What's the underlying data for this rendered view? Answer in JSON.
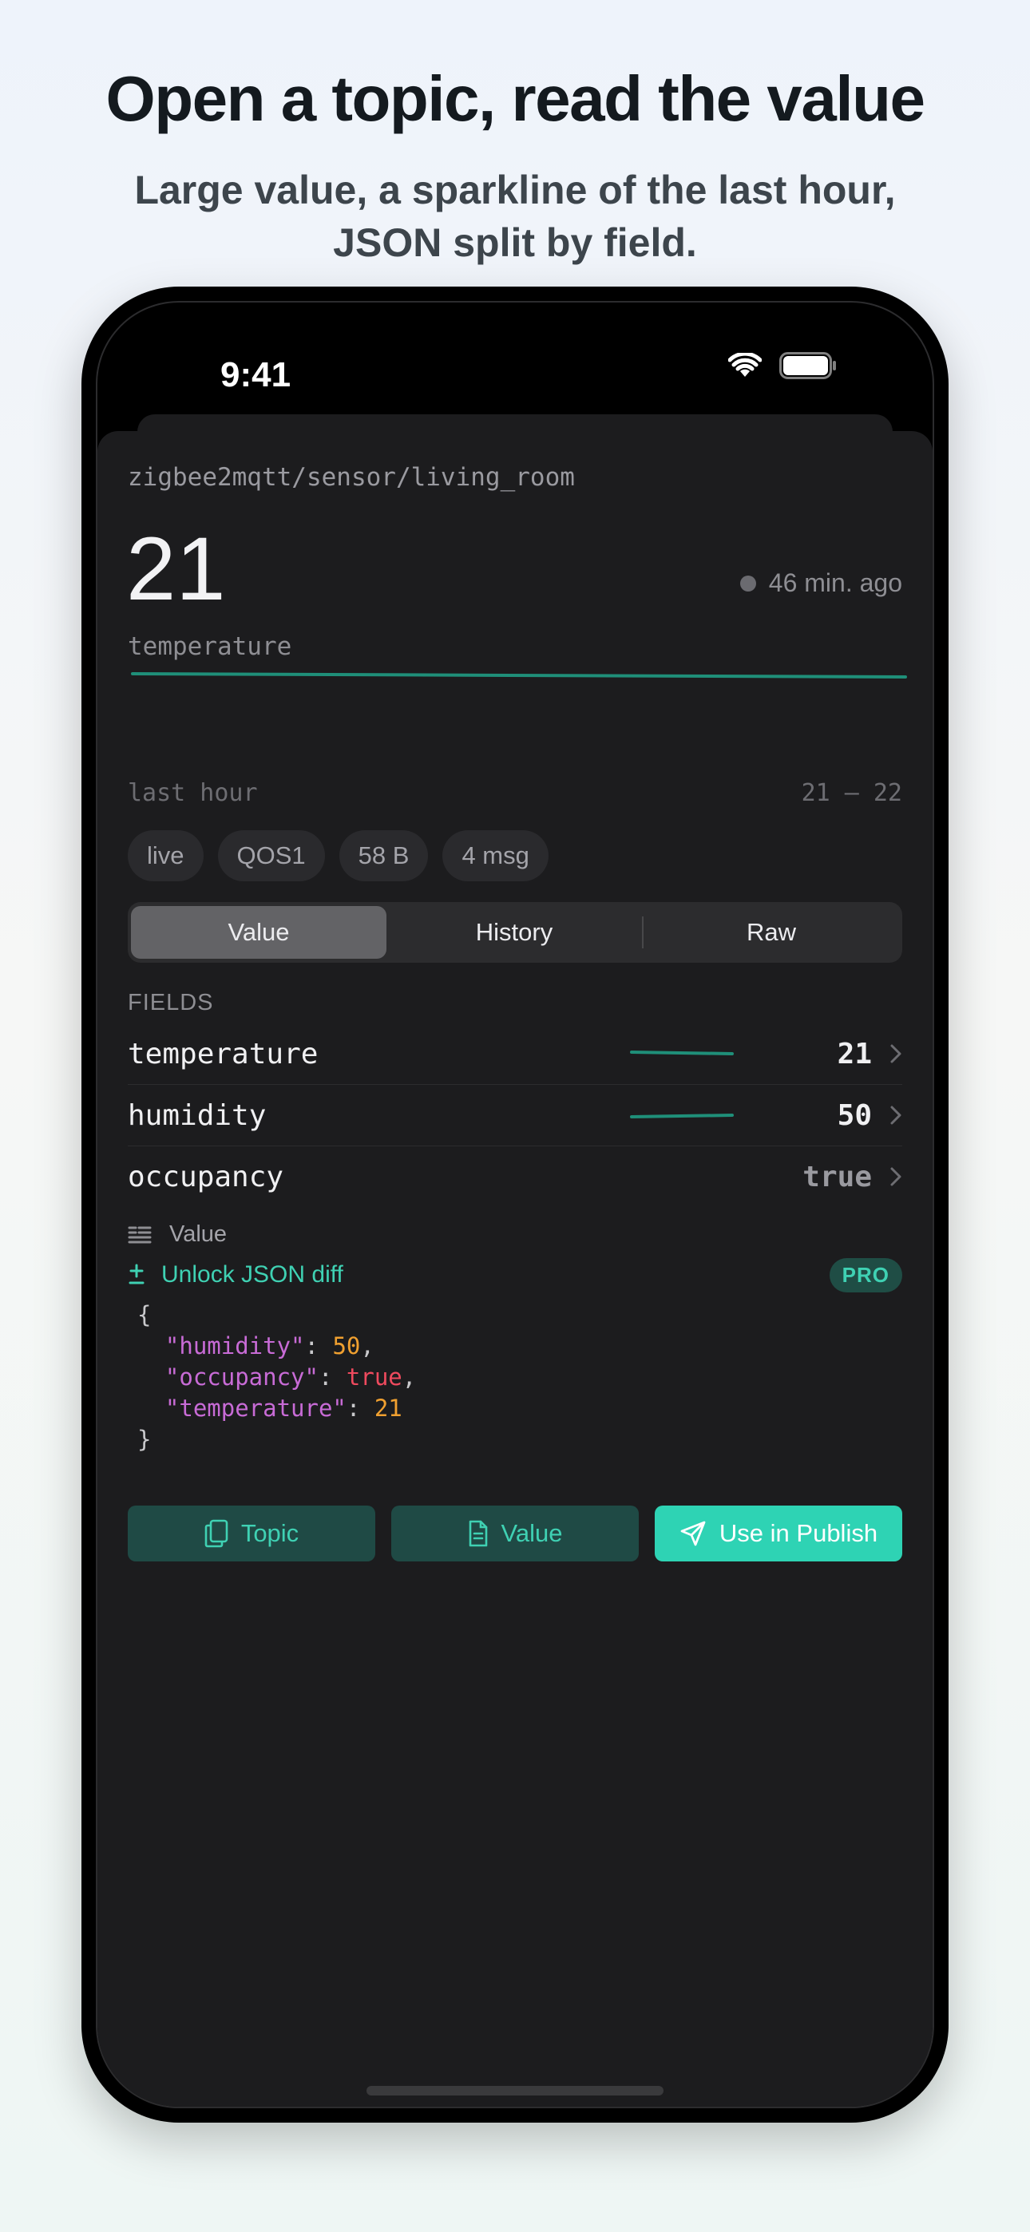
{
  "header": {
    "headline": "Open a topic, read the value",
    "subline": "Large value, a sparkline of the last hour, JSON split by field."
  },
  "status_bar": {
    "time": "9:41",
    "icons": [
      "wifi-icon",
      "battery-icon"
    ]
  },
  "detail": {
    "topic": "zigbee2mqtt/sensor/living_room",
    "value": "21",
    "ago": "46 min. ago",
    "field": "temperature",
    "range_label": "last hour",
    "range_value": "21 — 22",
    "chips": [
      "live",
      "QOS1",
      "58 B",
      "4 msg"
    ]
  },
  "tabs": {
    "items": [
      "Value",
      "History",
      "Raw"
    ],
    "selected": "Value"
  },
  "fields": {
    "title": "FIELDS",
    "rows": [
      {
        "name": "temperature",
        "value": "21"
      },
      {
        "name": "humidity",
        "value": "50"
      },
      {
        "name": "occupancy",
        "value": "true"
      }
    ]
  },
  "value_section": {
    "label": "Value",
    "unlock_label": "Unlock JSON diff",
    "pro_badge": "PRO",
    "json": {
      "open": "{",
      "close": "}",
      "lines": [
        {
          "key": "\"humidity\"",
          "value": "50",
          "kind": "number",
          "suffix": ","
        },
        {
          "key": "\"occupancy\"",
          "value": "true",
          "kind": "bool",
          "suffix": ","
        },
        {
          "key": "\"temperature\"",
          "value": "21",
          "kind": "number",
          "suffix": ""
        }
      ]
    }
  },
  "actions": {
    "topic": "Topic",
    "value": "Value",
    "publish": "Use in Publish"
  },
  "colors": {
    "accent": "#2ED3B4",
    "accent_dark": "#1F4A45",
    "sheet_bg": "#1C1C1E"
  }
}
